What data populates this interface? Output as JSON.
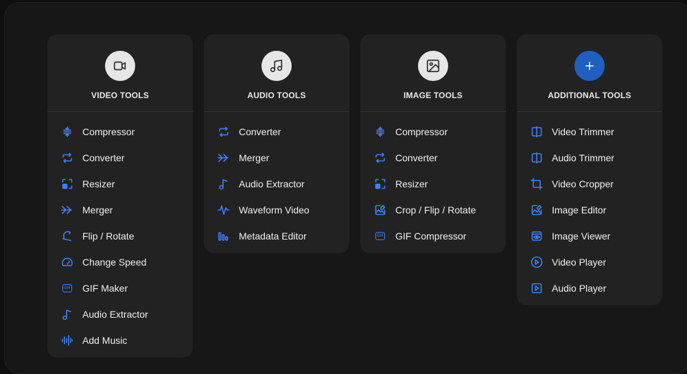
{
  "cards": [
    {
      "title": "VIDEO TOOLS",
      "icon": "video-camera-icon",
      "items": [
        {
          "label": "Compressor",
          "icon": "compress-icon"
        },
        {
          "label": "Converter",
          "icon": "convert-arrows-icon"
        },
        {
          "label": "Resizer",
          "icon": "resize-icon"
        },
        {
          "label": "Merger",
          "icon": "merge-arrows-icon"
        },
        {
          "label": "Flip / Rotate",
          "icon": "flip-rotate-icon"
        },
        {
          "label": "Change Speed",
          "icon": "speedometer-icon"
        },
        {
          "label": "GIF Maker",
          "icon": "gif-icon"
        },
        {
          "label": "Audio Extractor",
          "icon": "music-note-icon"
        },
        {
          "label": "Add Music",
          "icon": "audio-bars-icon"
        }
      ]
    },
    {
      "title": "AUDIO TOOLS",
      "icon": "music-notes-icon",
      "items": [
        {
          "label": "Converter",
          "icon": "convert-arrows-icon"
        },
        {
          "label": "Merger",
          "icon": "merge-arrows-icon"
        },
        {
          "label": "Audio Extractor",
          "icon": "music-note-icon"
        },
        {
          "label": "Waveform Video",
          "icon": "waveform-icon"
        },
        {
          "label": "Metadata Editor",
          "icon": "metadata-bars-icon"
        }
      ]
    },
    {
      "title": "IMAGE TOOLS",
      "icon": "image-icon",
      "items": [
        {
          "label": "Compressor",
          "icon": "compress-icon"
        },
        {
          "label": "Converter",
          "icon": "convert-arrows-icon"
        },
        {
          "label": "Resizer",
          "icon": "resize-icon"
        },
        {
          "label": "Crop / Flip / Rotate",
          "icon": "image-edit-icon"
        },
        {
          "label": "GIF Compressor",
          "icon": "gif-icon"
        }
      ]
    },
    {
      "title": "ADDITIONAL TOOLS",
      "icon": "plus-icon",
      "items": [
        {
          "label": "Video Trimmer",
          "icon": "trim-icon"
        },
        {
          "label": "Audio Trimmer",
          "icon": "trim-icon"
        },
        {
          "label": "Video Cropper",
          "icon": "crop-icon"
        },
        {
          "label": "Image Editor",
          "icon": "image-edit-icon"
        },
        {
          "label": "Image Viewer",
          "icon": "eye-window-icon"
        },
        {
          "label": "Video Player",
          "icon": "play-circle-icon"
        },
        {
          "label": "Audio Player",
          "icon": "play-square-icon"
        }
      ]
    }
  ],
  "colors": {
    "accent": "#3b82f6",
    "badge": "#e6e6e6",
    "badge_accent": "#1f5fbf",
    "card": "#222223"
  }
}
